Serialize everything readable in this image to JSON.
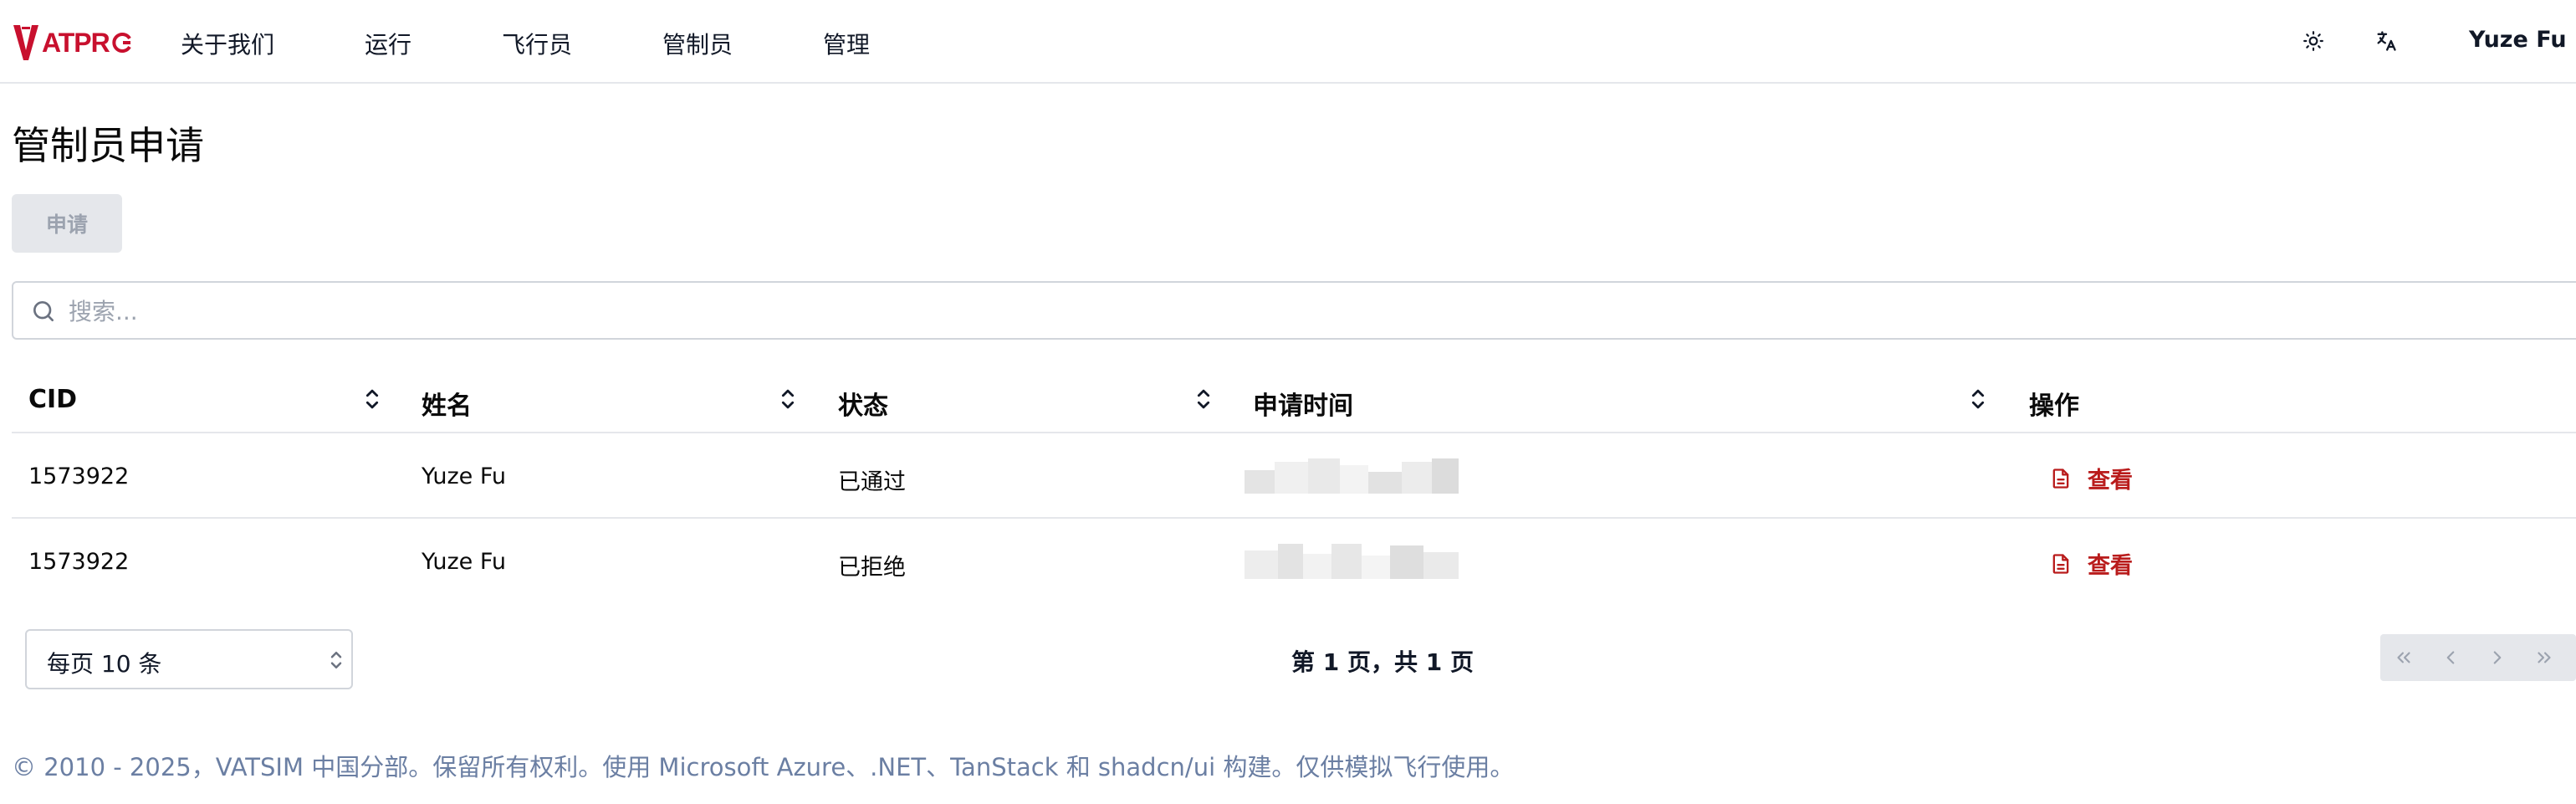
{
  "brand": {
    "logo_text": "ATPR"
  },
  "nav": {
    "items": [
      {
        "label": "关于我们"
      },
      {
        "label": "运行"
      },
      {
        "label": "飞行员"
      },
      {
        "label": "管制员"
      },
      {
        "label": "管理"
      }
    ],
    "user_name": "Yuze Fu"
  },
  "icons": {
    "theme": "sun-icon",
    "language": "translate-icon",
    "search": "search-icon",
    "sort": "chevrons-up-down-icon",
    "view": "file-text-icon"
  },
  "main": {
    "title": "管制员申请",
    "apply_button": "申请",
    "search": {
      "placeholder": "搜索...",
      "value": ""
    }
  },
  "table": {
    "columns": [
      {
        "label": "CID"
      },
      {
        "label": "姓名"
      },
      {
        "label": "状态"
      },
      {
        "label": "申请时间"
      },
      {
        "label": "操作"
      }
    ],
    "rows": [
      {
        "cid": "1573922",
        "name": "Yuze Fu",
        "status": "已通过",
        "action": "查看"
      },
      {
        "cid": "1573922",
        "name": "Yuze Fu",
        "status": "已拒绝",
        "action": "查看"
      }
    ]
  },
  "pagination": {
    "page_size_label": "每页 10 条",
    "page_info": "第 1 页，共 1 页"
  },
  "footer": {
    "text": "© 2010 - 2025，VATSIM 中国分部。保留所有权利。使用 Microsoft Azure、.NET、TanStack 和 shadcn/ui 构建。仅供模拟飞行使用。"
  },
  "colors": {
    "accent": "#c8102e",
    "link": "#b91c1c",
    "muted": "#6b7fa3",
    "border": "#e5e7eb"
  }
}
